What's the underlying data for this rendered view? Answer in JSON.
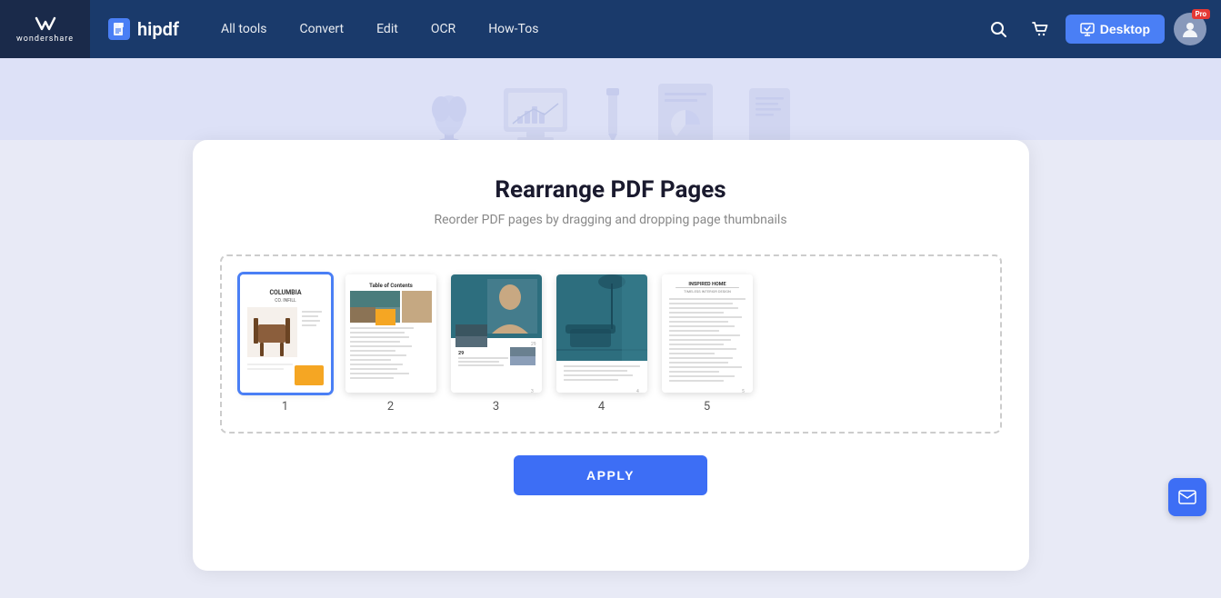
{
  "brand": {
    "wondershare_label": "wondershare",
    "hipdf_label": "hipdf"
  },
  "navbar": {
    "all_tools_label": "All tools",
    "convert_label": "Convert",
    "edit_label": "Edit",
    "ocr_label": "OCR",
    "howtos_label": "How-Tos",
    "desktop_label": "Desktop",
    "pro_badge": "Pro"
  },
  "hero": {
    "items": [
      {
        "icon": "🪴"
      },
      {
        "icon": "🖥️"
      },
      {
        "icon": "📊"
      },
      {
        "icon": "📄"
      }
    ]
  },
  "page_title": "Rearrange PDF Pages",
  "page_subtitle": "Reorder PDF pages by dragging and dropping page thumbnails",
  "pages": [
    {
      "number": "1",
      "selected": true
    },
    {
      "number": "2",
      "selected": false
    },
    {
      "number": "3",
      "selected": false
    },
    {
      "number": "4",
      "selected": false
    },
    {
      "number": "5",
      "selected": false
    }
  ],
  "apply_button_label": "APPLY",
  "colors": {
    "accent": "#3d6ef5",
    "navbar_bg": "#1a3a6b",
    "hero_bg": "#dde1f7"
  }
}
